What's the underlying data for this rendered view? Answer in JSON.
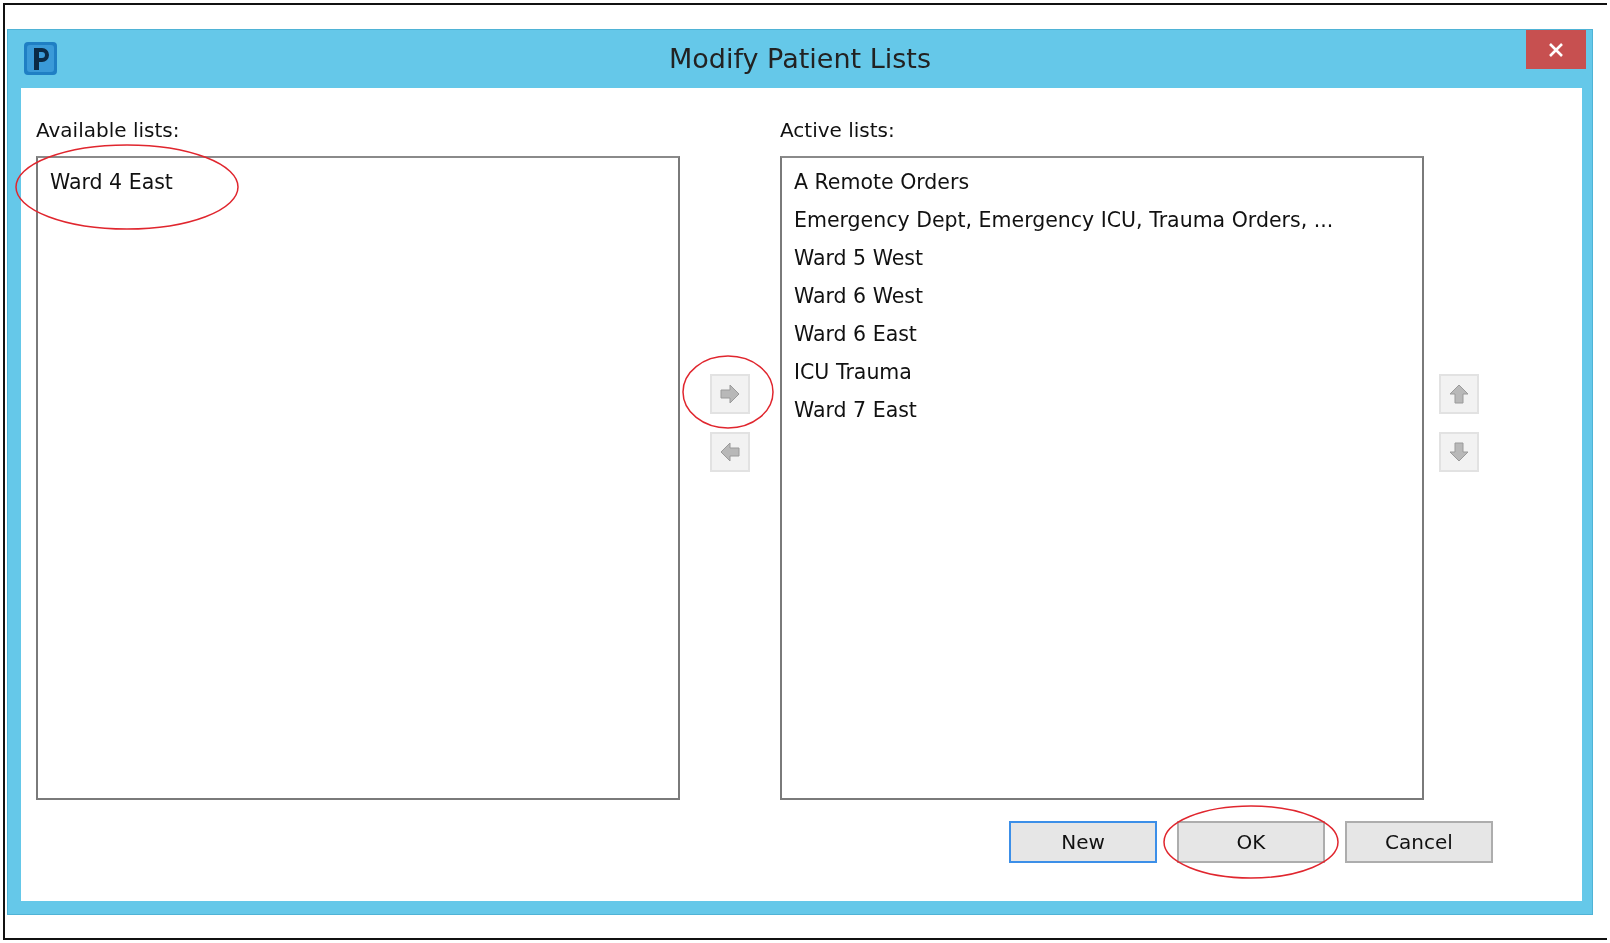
{
  "window": {
    "title": "Modify Patient Lists"
  },
  "available": {
    "label": "Available lists:",
    "items": [
      {
        "text": "Ward 4 East",
        "circled": true
      }
    ]
  },
  "transfer_buttons": [
    {
      "kind": "right",
      "circled": true
    },
    {
      "kind": "left",
      "circled": false
    }
  ],
  "active": {
    "label": "Active lists:",
    "items": [
      {
        "text": "A Remote Orders",
        "circled": false
      },
      {
        "text": "Emergency Dept, Emergency ICU, Trauma Orders, ...",
        "circled": false
      },
      {
        "text": "Ward 5 West",
        "circled": false
      },
      {
        "text": "Ward 6 West",
        "circled": false
      },
      {
        "text": "Ward 6 East",
        "circled": false
      },
      {
        "text": "ICU Trauma",
        "circled": false
      },
      {
        "text": "Ward 7 East",
        "circled": false
      }
    ]
  },
  "order_buttons": [
    {
      "kind": "up"
    },
    {
      "kind": "down"
    }
  ],
  "buttons": [
    {
      "label": "New",
      "focused": true,
      "circled": false
    },
    {
      "label": "OK",
      "focused": false,
      "circled": true
    },
    {
      "label": "Cancel",
      "focused": false,
      "circled": false
    }
  ]
}
